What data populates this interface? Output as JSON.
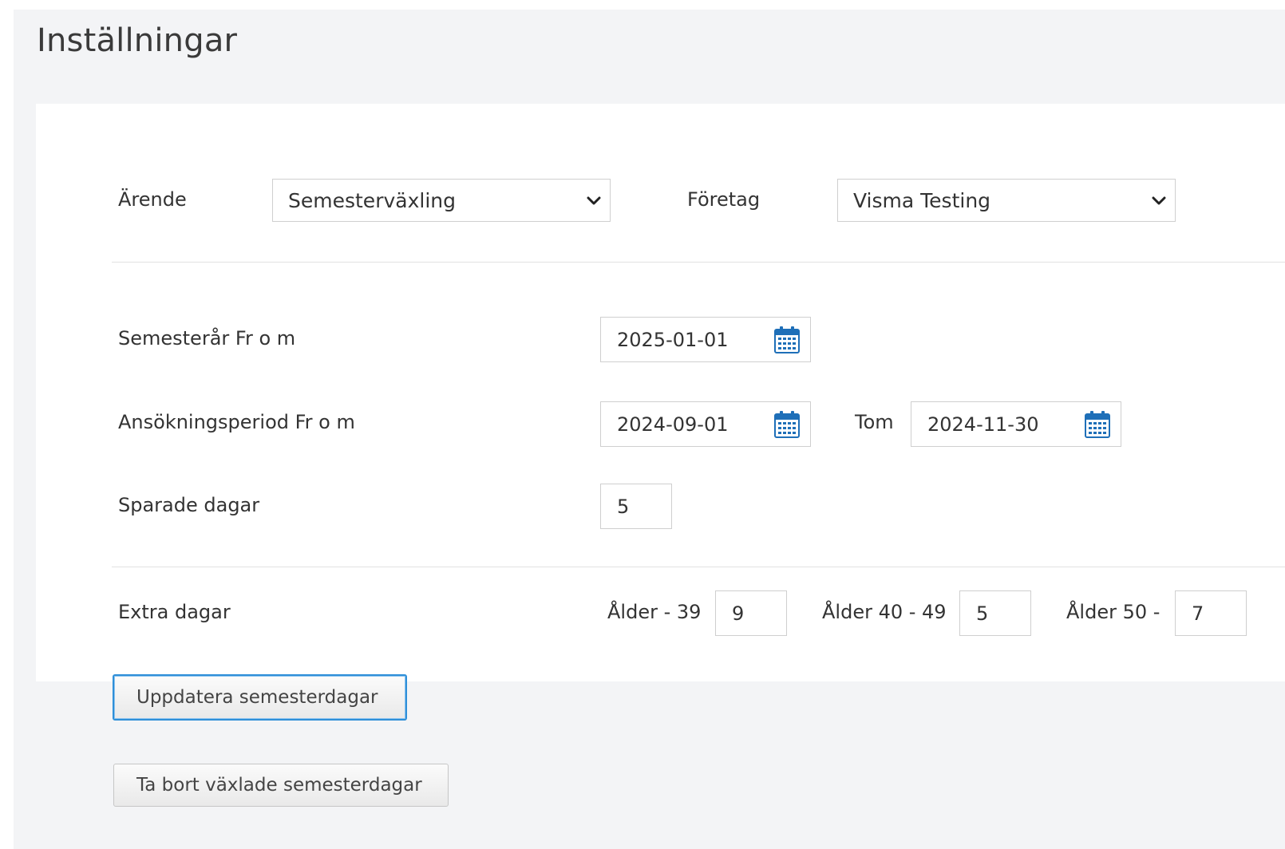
{
  "page": {
    "title": "Inställningar"
  },
  "case": {
    "label": "Ärende",
    "value": "Semesterväxling"
  },
  "company": {
    "label": "Företag",
    "value": "Visma Testing"
  },
  "vacation_year": {
    "label": "Semesterår Fr o m",
    "from": "2025-01-01"
  },
  "application_period": {
    "label": "Ansökningsperiod Fr o m",
    "from": "2024-09-01",
    "to_label": "Tom",
    "to": "2024-11-30"
  },
  "saved_days": {
    "label": "Sparade dagar",
    "value": "5"
  },
  "extra_days": {
    "label": "Extra dagar",
    "groups": [
      {
        "label": "Ålder - 39",
        "value": "9"
      },
      {
        "label": "Ålder 40 - 49",
        "value": "5"
      },
      {
        "label": "Ålder 50 -",
        "value": "7"
      }
    ]
  },
  "buttons": {
    "update": "Uppdatera semesterdagar",
    "delete": "Ta bort växlade semesterdagar"
  },
  "icons": {
    "calendar": "calendar-icon",
    "dropdown": "chevron-down-icon"
  },
  "colors": {
    "accent": "#2f8fd8",
    "calendar_blue": "#1e6fb8"
  }
}
